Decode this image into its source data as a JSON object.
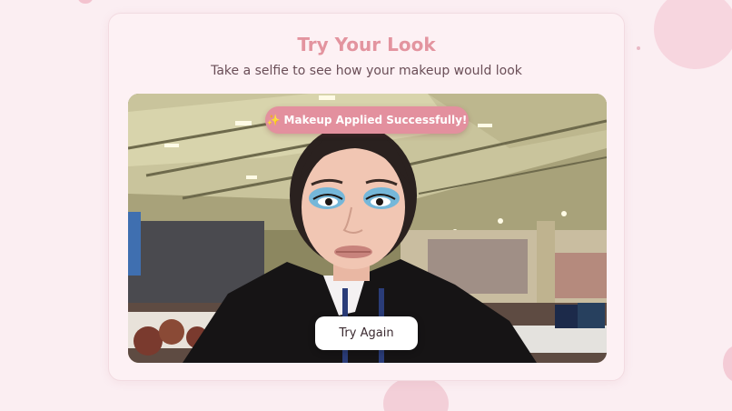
{
  "header": {
    "title": "Try Your Look",
    "subtitle": "Take a selfie to see how your makeup would look"
  },
  "preview": {
    "status_banner": "Makeup Applied Successfully!",
    "status_icon": "sparkles-icon",
    "retry_label": "Try Again"
  },
  "colors": {
    "page_background": "#fbeef2",
    "card_background": "#fdf1f4",
    "title_accent": "#e3949f",
    "banner_background": "#e3909e",
    "button_background": "#ffffff"
  }
}
